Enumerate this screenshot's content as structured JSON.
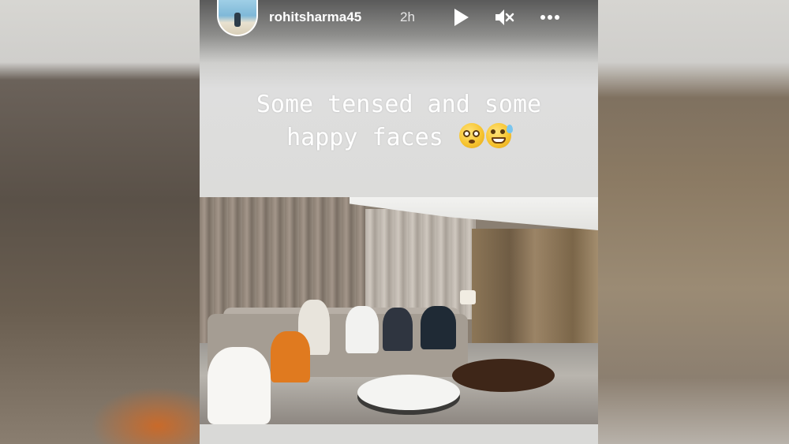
{
  "story": {
    "username": "rohitsharma45",
    "timestamp": "2h",
    "caption_line1": "Some tensed and some",
    "caption_line2": "happy faces",
    "emojis": [
      "flushed-face-emoji",
      "grinning-sweat-face-emoji"
    ]
  },
  "controls": {
    "play_icon": "play-icon",
    "mute_icon": "muted-speaker-icon",
    "more_icon": "more-icon"
  },
  "colors": {
    "caption_text": "#ffffff",
    "story_background": "#dcdcda"
  }
}
